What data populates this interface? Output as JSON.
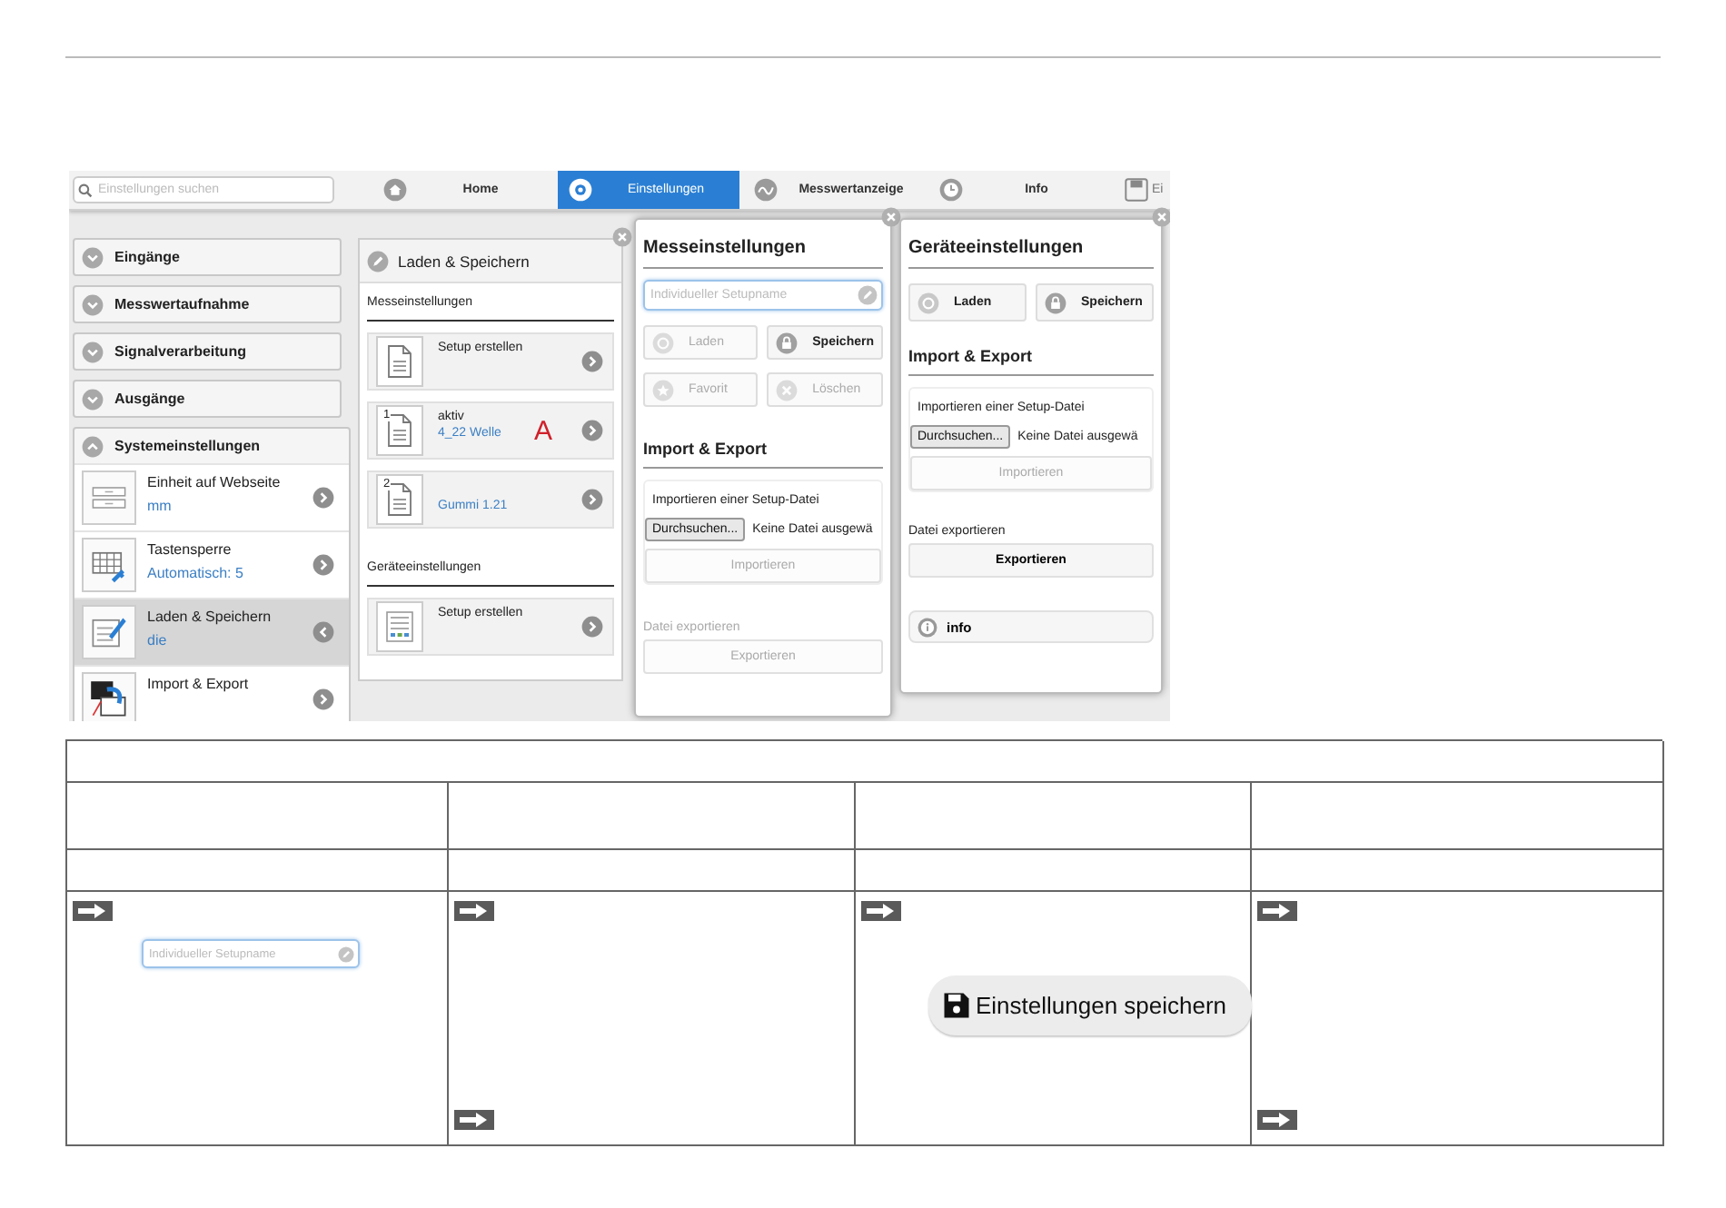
{
  "toolbar": {
    "search": {
      "placeholder": "Einstellungen suchen"
    },
    "tabs": [
      {
        "label": "Home",
        "kind": "home",
        "selected": false
      },
      {
        "label": "Einstellungen",
        "kind": "gear",
        "selected": true
      },
      {
        "label": "Messwertanzeige",
        "kind": "gauge",
        "selected": false
      },
      {
        "label": "Info",
        "kind": "clock",
        "selected": false
      },
      {
        "label": "Ei",
        "kind": "save",
        "selected": false
      }
    ]
  },
  "sidebar": {
    "sections": [
      {
        "label": "Eingänge",
        "expanded": false
      },
      {
        "label": "Messwertaufnahme",
        "expanded": false
      },
      {
        "label": "Signalverarbeitung",
        "expanded": false
      },
      {
        "label": "Ausgänge",
        "expanded": false
      },
      {
        "label": "Systemeinstellungen",
        "expanded": true,
        "items": [
          {
            "title": "Einheit auf Webseite",
            "value": "mm",
            "kind": "unit",
            "selected": false
          },
          {
            "title": "Tastensperre",
            "value": "Automatisch: 5",
            "kind": "keypad",
            "selected": false
          },
          {
            "title": "Laden & Speichern",
            "value": "die",
            "kind": "edit",
            "selected": true
          },
          {
            "title": "Import & Export",
            "kind": "import",
            "selected": false
          }
        ]
      }
    ]
  },
  "panel": {
    "title": "Laden & Speichern",
    "groups": [
      {
        "heading": "Messeinstellungen",
        "items": [
          {
            "title": "Setup erstellen",
            "kind": "doc"
          },
          {
            "title": "aktiv",
            "value": "4_22 Welle",
            "kind": "doc",
            "number": "1",
            "marker": "A"
          },
          {
            "value": "Gummi 1.21",
            "kind": "doc",
            "number": "2"
          }
        ]
      },
      {
        "heading": "Geräteeinstellungen",
        "items": [
          {
            "title": "Setup erstellen",
            "kind": "grid"
          }
        ]
      }
    ]
  },
  "popups": [
    {
      "title": "Messeinstellungen",
      "name_field": {
        "placeholder": "Individueller Setupname"
      },
      "buttons": [
        {
          "label": "Laden",
          "kind": "load",
          "disabled": true
        },
        {
          "label": "Speichern",
          "kind": "lock",
          "disabled": false
        },
        {
          "label": "Favorit",
          "kind": "star",
          "disabled": true
        },
        {
          "label": "Löschen",
          "kind": "cross",
          "disabled": true
        }
      ],
      "import_export": {
        "title": "Import & Export",
        "import_label": "Importieren einer Setup-Datei",
        "browse_button": "Durchsuchen...",
        "file_status": "Keine Datei ausgewä",
        "import_button": {
          "label": "Importieren",
          "disabled": true
        },
        "export_label": "Datei exportieren",
        "export_button": {
          "label": "Exportieren",
          "disabled": true
        }
      }
    },
    {
      "title": "Geräteeinstellungen",
      "buttons": [
        {
          "label": "Laden",
          "kind": "load",
          "disabled": false
        },
        {
          "label": "Speichern",
          "kind": "lock",
          "disabled": false
        }
      ],
      "import_export": {
        "title": "Import & Export",
        "import_label": "Importieren einer Setup-Datei",
        "browse_button": "Durchsuchen...",
        "file_status": "Keine Datei ausgewä",
        "import_button": {
          "label": "Importieren",
          "disabled": true
        },
        "export_label": "Datei exportieren",
        "export_button": {
          "label": "Exportieren",
          "disabled": false
        }
      },
      "info_button": "info"
    }
  ],
  "table": {
    "last_row": [
      {
        "items": [
          {
            "kind": "arrow"
          },
          {
            "kind": "field",
            "placeholder": "Individueller Setupname"
          }
        ]
      },
      {
        "items": [
          {
            "kind": "arrow"
          },
          {
            "kind": "bottom_arrow"
          }
        ]
      },
      {
        "items": [
          {
            "kind": "arrow"
          },
          {
            "kind": "button",
            "label": "Einstellungen speichern"
          }
        ]
      },
      {
        "items": [
          {
            "kind": "arrow"
          },
          {
            "kind": "bottom_arrow"
          }
        ]
      }
    ]
  }
}
